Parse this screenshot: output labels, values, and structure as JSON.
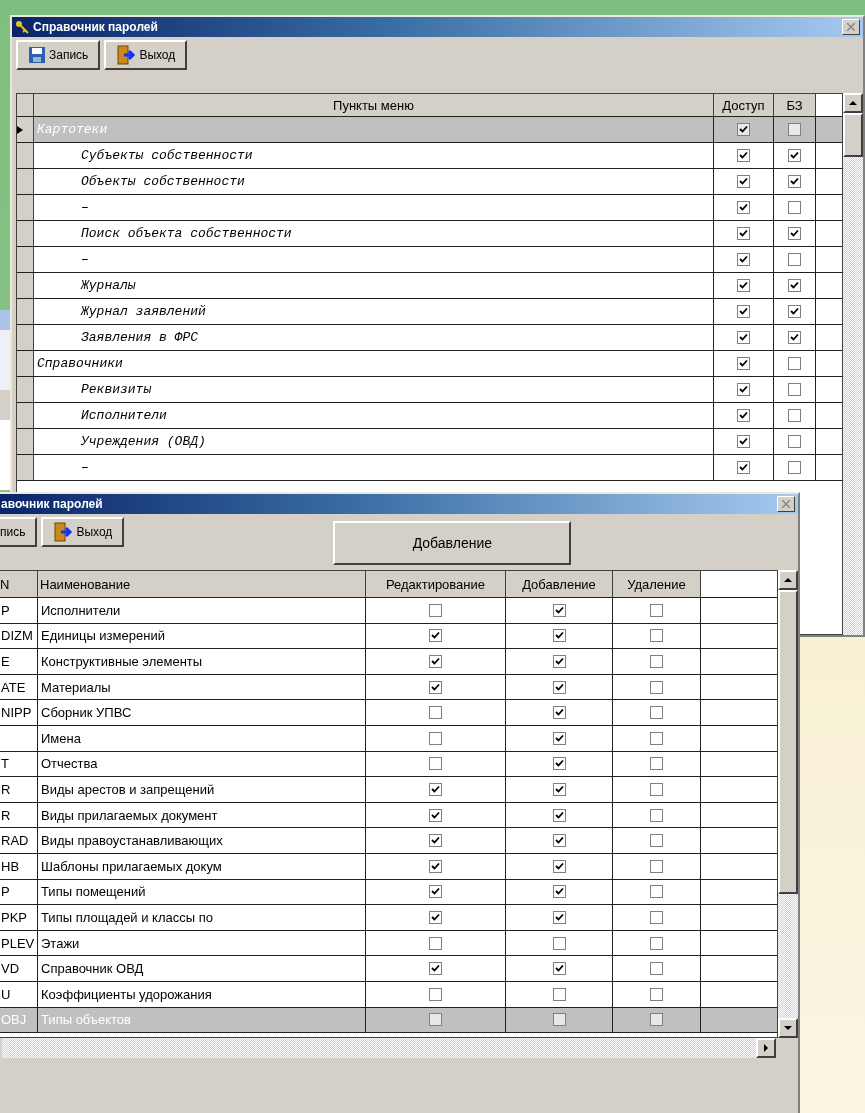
{
  "back_window": {
    "title": "Справочник паролей",
    "buttons": [
      {
        "kind": "save",
        "label": "Запись"
      },
      {
        "kind": "exit",
        "label": "Выход"
      }
    ],
    "columns": [
      "Пункты меню",
      "Доступ",
      "БЗ"
    ],
    "rows": [
      {
        "name": "Картотеки",
        "access": true,
        "bz": false,
        "selected": true,
        "children": [
          {
            "name": "Субъекты собственности",
            "access": true,
            "bz": true,
            "selected": false
          },
          {
            "name": "Объекты собственности",
            "access": true,
            "bz": true,
            "selected": false
          },
          {
            "name": "–",
            "access": true,
            "bz": false,
            "selected": false
          },
          {
            "name": "Поиск объекта собственности",
            "access": true,
            "bz": true,
            "selected": false
          },
          {
            "name": "–",
            "access": true,
            "bz": false,
            "selected": false
          },
          {
            "name": "Журналы",
            "access": true,
            "bz": true,
            "selected": false
          },
          {
            "name": "Журнал заявлений",
            "access": true,
            "bz": true,
            "selected": false
          },
          {
            "name": "Заявления в ФРС",
            "access": true,
            "bz": true,
            "selected": false
          }
        ]
      },
      {
        "name": "Справочники",
        "access": true,
        "bz": false,
        "selected": false,
        "children": [
          {
            "name": "Реквизиты",
            "access": true,
            "bz": false,
            "selected": false
          },
          {
            "name": "Исполнители",
            "access": true,
            "bz": false,
            "selected": false
          },
          {
            "name": "Учреждения (ОВД)",
            "access": true,
            "bz": false,
            "selected": false
          },
          {
            "name": "–",
            "access": true,
            "bz": false,
            "selected": false
          }
        ]
      }
    ]
  },
  "front_window": {
    "title": "авочник паролей",
    "buttons": [
      {
        "kind": "save",
        "label": "пись"
      },
      {
        "kind": "exit",
        "label": "Выход"
      }
    ],
    "action_button": "Добавление",
    "columns": [
      "N",
      "Наименование",
      "Редактирование",
      "Добавление",
      "Удаление"
    ],
    "rows": [
      {
        "code": "P",
        "name": "Исполнители",
        "edit": false,
        "add": true,
        "delete": false,
        "selected": false
      },
      {
        "code": "DIZM",
        "name": "Единицы измерений",
        "edit": true,
        "add": true,
        "delete": false,
        "selected": false
      },
      {
        "code": "E",
        "name": "Конструктивные элементы",
        "edit": true,
        "add": true,
        "delete": false,
        "selected": false
      },
      {
        "code": "ATE",
        "name": "Материалы",
        "edit": true,
        "add": true,
        "delete": false,
        "selected": false
      },
      {
        "code": "NIPP",
        "name": "Сборник УПВС",
        "edit": false,
        "add": true,
        "delete": false,
        "selected": false
      },
      {
        "name": "Имена",
        "edit": false,
        "add": true,
        "delete": false,
        "selected": false
      },
      {
        "code": "T",
        "name": "Отчества",
        "edit": false,
        "add": true,
        "delete": false,
        "selected": false
      },
      {
        "code": "R",
        "name": "Виды арестов и запрещений",
        "edit": true,
        "add": true,
        "delete": false,
        "selected": false
      },
      {
        "code": "R",
        "name": "Виды прилагаемых документ",
        "edit": true,
        "add": true,
        "delete": false,
        "selected": false
      },
      {
        "code": "RAD",
        "name": "Виды правоустанавливающих",
        "edit": true,
        "add": true,
        "delete": false,
        "selected": false
      },
      {
        "code": "HB",
        "name": "Шаблоны прилагаемых докум",
        "edit": true,
        "add": true,
        "delete": false,
        "selected": false
      },
      {
        "code": "P",
        "name": "Типы помещений",
        "edit": true,
        "add": true,
        "delete": false,
        "selected": false
      },
      {
        "code": "PKP",
        "name": "Типы площадей и классы по",
        "edit": true,
        "add": true,
        "delete": false,
        "selected": false
      },
      {
        "code": "PLEV",
        "name": "Этажи",
        "edit": false,
        "add": false,
        "delete": false,
        "selected": false
      },
      {
        "code": "VD",
        "name": "Справочник ОВД",
        "edit": true,
        "add": true,
        "delete": false,
        "selected": false
      },
      {
        "code": "U",
        "name": "Коэффициенты удорожания",
        "edit": false,
        "add": false,
        "delete": false,
        "selected": false
      },
      {
        "code": "OBJ",
        "name": "Типы объектов",
        "edit": false,
        "add": false,
        "delete": false,
        "selected": true
      }
    ]
  }
}
